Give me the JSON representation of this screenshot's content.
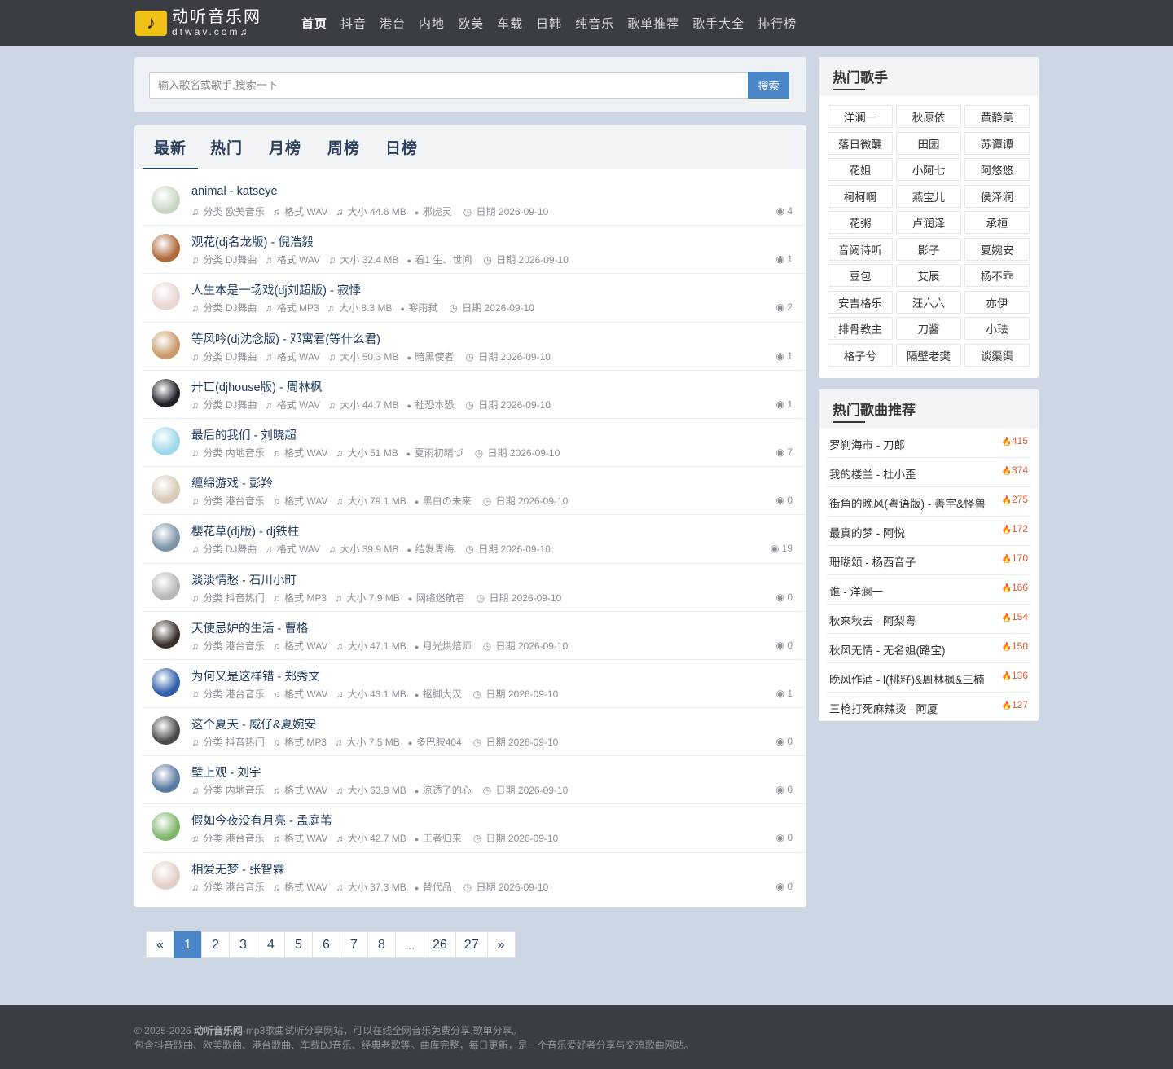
{
  "header": {
    "logo_title": "动听音乐网",
    "logo_sub": "dtwav.com♫",
    "nav": [
      "首页",
      "抖音",
      "港台",
      "内地",
      "欧美",
      "车载",
      "日韩",
      "纯音乐",
      "歌单推荐",
      "歌手大全",
      "排行榜"
    ]
  },
  "search": {
    "placeholder": "输入歌名或歌手,搜索一下",
    "button": "搜索"
  },
  "tabs": [
    "最新",
    "热门",
    "月榜",
    "周榜",
    "日榜"
  ],
  "meta_labels": {
    "category": "分类",
    "format": "格式",
    "size": "大小",
    "date": "日期"
  },
  "songs": [
    {
      "title": "animal - katseye",
      "category": "欧美音乐",
      "format": "WAV",
      "size": "44.6 MB",
      "uploader": "邪虎灵",
      "date": "2026-09-10",
      "views": "4"
    },
    {
      "title": "观花(dj名龙版) - 倪浩毅",
      "category": "DJ舞曲",
      "format": "WAV",
      "size": "32.4 MB",
      "uploader": "看1 生、世间",
      "date": "2026-09-10",
      "views": "1"
    },
    {
      "title": "人生本是一场戏(dj刘超版) - 寂悸",
      "category": "DJ舞曲",
      "format": "MP3",
      "size": "8.3 MB",
      "uploader": "寒雨弑",
      "date": "2026-09-10",
      "views": "2"
    },
    {
      "title": "等风吟(dj沈念版) - 邓寓君(等什么君)",
      "category": "DJ舞曲",
      "format": "WAV",
      "size": "50.3 MB",
      "uploader": "暗黑使者",
      "date": "2026-09-10",
      "views": "1"
    },
    {
      "title": "廾匸(djhouse版) - 周林枫",
      "category": "DJ舞曲",
      "format": "WAV",
      "size": "44.7 MB",
      "uploader": "社恐本恐",
      "date": "2026-09-10",
      "views": "1"
    },
    {
      "title": "最后的我们 - 刘晓超",
      "category": "内地音乐",
      "format": "WAV",
      "size": "51 MB",
      "uploader": "夏雨初晴づ",
      "date": "2026-09-10",
      "views": "7"
    },
    {
      "title": "缠绵游戏 - 彭羚",
      "category": "港台音乐",
      "format": "WAV",
      "size": "79.1 MB",
      "uploader": "黑白の未来",
      "date": "2026-09-10",
      "views": "0"
    },
    {
      "title": "樱花草(dj版) - dj铁柱",
      "category": "DJ舞曲",
      "format": "WAV",
      "size": "39.9 MB",
      "uploader": "结发青梅",
      "date": "2026-09-10",
      "views": "19"
    },
    {
      "title": "淡淡情愁 - 石川小町",
      "category": "抖音热门",
      "format": "MP3",
      "size": "7.9 MB",
      "uploader": "网络迷航者",
      "date": "2026-09-10",
      "views": "0"
    },
    {
      "title": "天使忌妒的生活 - 曹格",
      "category": "港台音乐",
      "format": "WAV",
      "size": "47.1 MB",
      "uploader": "月光烘焙师",
      "date": "2026-09-10",
      "views": "0"
    },
    {
      "title": "为何又是这样错 - 郑秀文",
      "category": "港台音乐",
      "format": "WAV",
      "size": "43.1 MB",
      "uploader": "抠脚大汉",
      "date": "2026-09-10",
      "views": "1"
    },
    {
      "title": "这个夏天 - 威仔&夏婉安",
      "category": "抖音热门",
      "format": "MP3",
      "size": "7.5 MB",
      "uploader": "多巴胺404",
      "date": "2026-09-10",
      "views": "0"
    },
    {
      "title": "壁上观 - 刘宇",
      "category": "内地音乐",
      "format": "WAV",
      "size": "63.9 MB",
      "uploader": "凉透了的心",
      "date": "2026-09-10",
      "views": "0"
    },
    {
      "title": "假如今夜没有月亮 - 孟庭苇",
      "category": "港台音乐",
      "format": "WAV",
      "size": "42.7 MB",
      "uploader": "王者归来",
      "date": "2026-09-10",
      "views": "0"
    },
    {
      "title": "相爱无梦 - 张智霖",
      "category": "港台音乐",
      "format": "WAV",
      "size": "37.3 MB",
      "uploader": "替代品",
      "date": "2026-09-10",
      "views": "0"
    }
  ],
  "avatar_colors": [
    "#c9d6c4",
    "#b06a3c",
    "#e8d6d2",
    "#c99a6b",
    "#1e2228",
    "#9fd8e8",
    "#d8c9b8",
    "#7f93a8",
    "#b8b8b8",
    "#3a2f2c",
    "#2f5fa8",
    "#4a4a4a",
    "#5a7aa0",
    "#7fb56a",
    "#e2cfc6"
  ],
  "pagination": [
    "«",
    "1",
    "2",
    "3",
    "4",
    "5",
    "6",
    "7",
    "8",
    "…",
    "26",
    "27",
    "»"
  ],
  "pagination_active": "1",
  "singers": {
    "title": "热门歌手",
    "items": [
      "洋澜一",
      "秋原依",
      "黄静美",
      "落日微醺",
      "田园",
      "苏谭谭",
      "花姐",
      "小阿七",
      "阿悠悠",
      "柯柯啊",
      "燕宝儿",
      "侯泽润",
      "花粥",
      "卢润泽",
      "承桓",
      "音阙诗听",
      "影子",
      "夏婉安",
      "豆包",
      "艾辰",
      "杨不乖",
      "安吉格乐",
      "汪六六",
      "亦伊",
      "排骨教主",
      "刀酱",
      "小珐",
      "格子兮",
      "隔壁老樊",
      "谈渠渠"
    ]
  },
  "hot_songs": {
    "title": "热门歌曲推荐",
    "items": [
      {
        "name": "罗刹海市 - 刀郎",
        "count": "415"
      },
      {
        "name": "我的楼兰 - 杜小歪",
        "count": "374"
      },
      {
        "name": "街角的晚风(粤语版) - 善宇&怪兽",
        "count": "275"
      },
      {
        "name": "最真的梦 - 阿悦",
        "count": "172"
      },
      {
        "name": "珊瑚颂 - 杨西音子",
        "count": "170"
      },
      {
        "name": "谁 - 洋澜一",
        "count": "166"
      },
      {
        "name": "秋来秋去 - 阿梨粤",
        "count": "154"
      },
      {
        "name": "秋风无情 - 无名姐(路宝)",
        "count": "150"
      },
      {
        "name": "晚风作酒 - l(桃籽)&周林枫&三楠",
        "count": "136"
      },
      {
        "name": "三枪打死麻辣烫 - 阿厦",
        "count": "127"
      }
    ]
  },
  "footer": {
    "copyright": "© 2025-2026",
    "site_name": "动听音乐网",
    "line1_rest": "-mp3歌曲试听分享网站，可以在线全网音乐免费分享,歌单分享。",
    "line2": "包含抖音歌曲、欧美歌曲、港台歌曲、车载DJ音乐、经典老歌等。曲库完整，每日更新，是一个音乐爱好者分享与交流歌曲网站。"
  },
  "colors": {
    "nav_bg": "#3a3d44",
    "accent": "#4a86c8",
    "page_bg": "#ccd7e3",
    "hot_count": "#e05a2b"
  }
}
